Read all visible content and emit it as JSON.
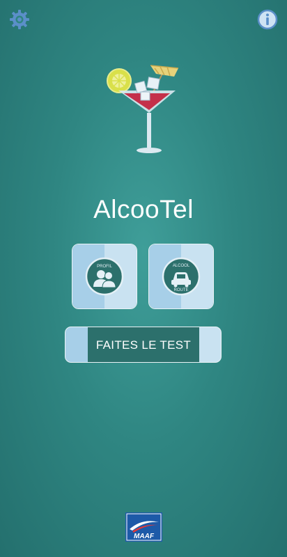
{
  "app": {
    "title": "AlcooTel"
  },
  "header": {
    "settings_icon": "gear-icon",
    "info_icon": "info-icon"
  },
  "tiles": [
    {
      "id": "profil",
      "label": "PROFIL",
      "icon": "people-icon"
    },
    {
      "id": "alcool-route",
      "label_top": "ALCOOL",
      "label_bottom": "ROUTE",
      "icon": "car-icon"
    }
  ],
  "action": {
    "test_label": "FAITES LE TEST"
  },
  "footer": {
    "logo_text": "MAAF"
  },
  "colors": {
    "background": "#2f8682",
    "tile_light": "#c9e2f1",
    "tile_mid": "#a7cfe8",
    "button_core": "#2c706c",
    "icon_blue": "#5b8fc9",
    "logo_blue": "#1d5aa8"
  }
}
